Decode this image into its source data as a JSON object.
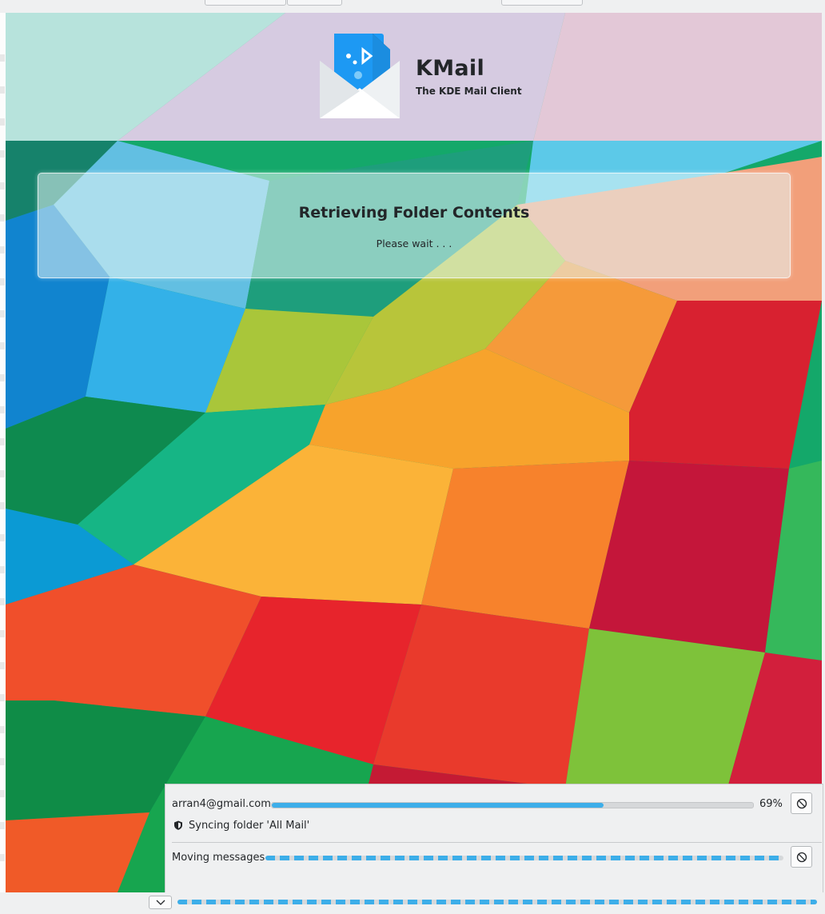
{
  "app": {
    "name": "KMail",
    "subtitle": "The KDE Mail Client"
  },
  "panel": {
    "title": "Retrieving Folder Contents",
    "message": "Please wait . . ."
  },
  "progress": {
    "account": "arran4@gmail.com",
    "percent_value": 0.69,
    "percent_label": "69%",
    "status": "Syncing folder 'All Mail'",
    "task_label": "Moving messages",
    "cancel_icon": "cancel-icon",
    "status_icon": "shield-icon"
  },
  "bottom": {
    "toggle_icon": "chevron-down-icon"
  },
  "colors": {
    "accent": "#3daee9",
    "text": "#232629",
    "window": "#eff0f1"
  }
}
